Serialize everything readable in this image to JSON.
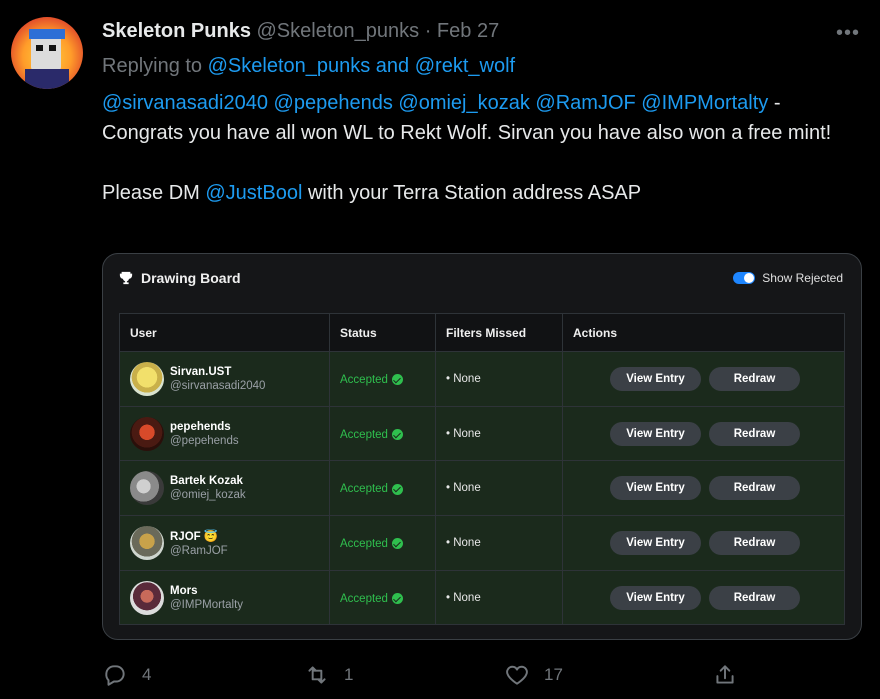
{
  "tweet": {
    "author_name": "Skeleton Punks",
    "author_handle": "@Skeleton_punks",
    "separator": " · ",
    "date": "Feb 27",
    "replying_prefix": "Replying to ",
    "replying_to": "@Skeleton_punks and @rekt_wolf",
    "mentions": [
      "@sirvanasadi2040",
      "@pepehends",
      "@omiej_kozak",
      "@RamJOF",
      "@IMPMortalty"
    ],
    "dash": " -",
    "line1": "Congrats you have all won WL to Rekt Wolf. Sirvan you have also won a free mint!",
    "dm_prefix": "Please DM ",
    "dm_handle": "@JustBool",
    "dm_suffix": " with your Terra Station address ASAP"
  },
  "card": {
    "title": "Drawing Board",
    "toggle_label": "Show Rejected",
    "toggle_on": true,
    "columns": [
      "User",
      "Status",
      "Filters Missed",
      "Actions"
    ],
    "rows": [
      {
        "name": "Sirvan.UST",
        "handle": "@sirvanasadi2040",
        "status": "Accepted",
        "filters": "• None",
        "view": "View Entry",
        "redraw": "Redraw"
      },
      {
        "name": "pepehends",
        "handle": "@pepehends",
        "status": "Accepted",
        "filters": "• None",
        "view": "View Entry",
        "redraw": "Redraw"
      },
      {
        "name": "Bartek Kozak",
        "handle": "@omiej_kozak",
        "status": "Accepted",
        "filters": "• None",
        "view": "View Entry",
        "redraw": "Redraw"
      },
      {
        "name": "RJOF 😇",
        "handle": "@RamJOF",
        "status": "Accepted",
        "filters": "• None",
        "view": "View Entry",
        "redraw": "Redraw"
      },
      {
        "name": "Mors",
        "handle": "@IMPMortalty",
        "status": "Accepted",
        "filters": "• None",
        "view": "View Entry",
        "redraw": "Redraw"
      }
    ],
    "colors": {
      "accent": "#1d9bf0",
      "accepted": "#2fbf4e",
      "row_bg": "#1b2a1c"
    }
  },
  "actions": {
    "reply_count": "4",
    "retweet_count": "1",
    "like_count": "17"
  }
}
